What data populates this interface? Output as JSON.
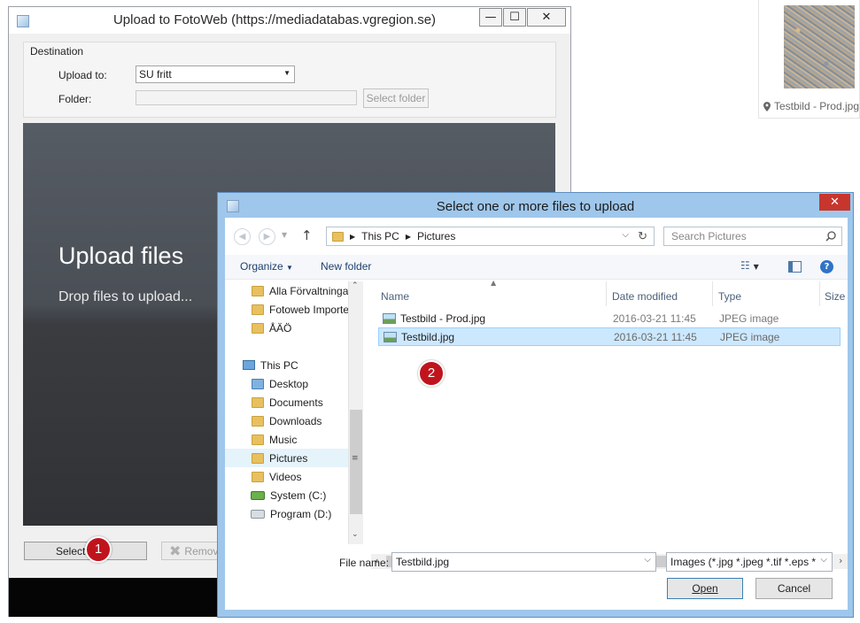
{
  "background_thumbnail": {
    "caption": "Testbild - Prod.jpg"
  },
  "upload_window": {
    "title": "Upload to FotoWeb (https://mediadatabas.vgregion.se)",
    "caption_buttons": {
      "minimize": "—",
      "maximize": "☐",
      "close": "✕"
    },
    "destination": {
      "group_label": "Destination",
      "upload_to_label": "Upload to:",
      "upload_to_value": "SU fritt",
      "folder_label": "Folder:",
      "folder_value": "",
      "select_folder_label": "Select folder"
    },
    "drop_area": {
      "title": "Upload files",
      "subtitle": "Drop files to upload..."
    },
    "select_label": "Select",
    "remove_label": "Remove",
    "badge_1": "1"
  },
  "file_dialog": {
    "title": "Select one or more files to upload",
    "close_label": "✕",
    "address": {
      "crumbs": [
        "This PC",
        "Pictures"
      ]
    },
    "search_placeholder": "Search Pictures",
    "toolbar": {
      "organize": "Organize",
      "new_folder": "New folder"
    },
    "nav_items": [
      {
        "label": "Alla Förvaltningar",
        "kind": "folder"
      },
      {
        "label": "Fotoweb Importer",
        "kind": "folder"
      },
      {
        "label": "ÅÄÖ",
        "kind": "folder"
      },
      {
        "label": "This PC",
        "kind": "pc"
      },
      {
        "label": "Desktop",
        "kind": "folder"
      },
      {
        "label": "Documents",
        "kind": "folder"
      },
      {
        "label": "Downloads",
        "kind": "folder"
      },
      {
        "label": "Music",
        "kind": "folder"
      },
      {
        "label": "Pictures",
        "kind": "folder",
        "selected": true
      },
      {
        "label": "Videos",
        "kind": "folder"
      },
      {
        "label": "System (C:)",
        "kind": "drive"
      },
      {
        "label": "Program (D:)",
        "kind": "drive"
      }
    ],
    "columns": {
      "name": "Name",
      "date": "Date modified",
      "type": "Type",
      "size": "Size"
    },
    "files": [
      {
        "name": "Testbild - Prod.jpg",
        "date": "2016-03-21 11:45",
        "type": "JPEG image",
        "selected": false
      },
      {
        "name": "Testbild.jpg",
        "date": "2016-03-21 11:45",
        "type": "JPEG image",
        "selected": true
      }
    ],
    "badge_2": "2",
    "file_name_label": "File name:",
    "file_name_value": "Testbild.jpg",
    "filter_value": "Images (*.jpg *.jpeg *.tif *.eps *",
    "open_label": "Open",
    "cancel_label": "Cancel"
  },
  "colors": {
    "accent": "#c0141d",
    "selection": "#cce8ff",
    "dialog_frame": "#9fc7eb"
  }
}
